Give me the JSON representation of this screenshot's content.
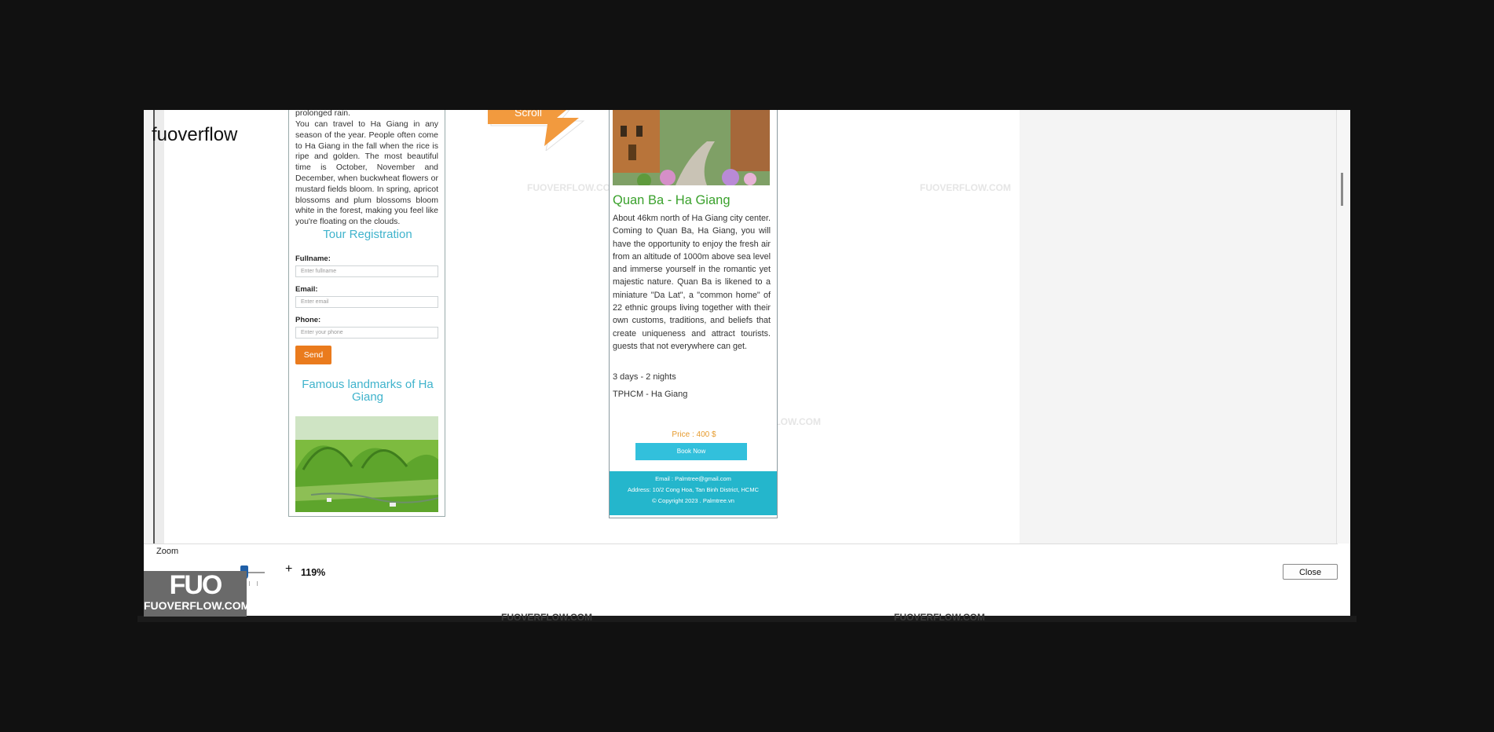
{
  "app": {
    "title": "fuoverflow"
  },
  "left_page": {
    "para_top": "prolonged rain.",
    "para_main": "You can travel to Ha Giang in any season of the year. People often come to Ha Giang in the fall when the rice is ripe and golden. The most beautiful time is October, November and December, when buckwheat flowers or mustard fields bloom. In spring, apricot blossoms and plum blossoms bloom white in the forest, making you feel like you're floating on the clouds.",
    "form_title": "Tour Registration",
    "fullname_label": "Fullname:",
    "fullname_placeholder": "Enter fullname",
    "email_label": "Email:",
    "email_placeholder": "Enter email",
    "phone_label": "Phone:",
    "phone_placeholder": "Enter your phone",
    "send_label": "Send",
    "landmarks_title": "Famous landmarks of Ha Giang"
  },
  "arrow": {
    "label": "Scroll"
  },
  "middle_page": {
    "title": "Quan Ba - Ha Giang",
    "desc": "About 46km north of Ha Giang city center. Coming to Quan Ba, Ha Giang, you will have the opportunity to enjoy the fresh air from an altitude of 1000m above sea level and immerse yourself in the romantic yet majestic nature. Quan Ba is likened to a miniature \"Da Lat\", a \"common home\" of 22 ethnic groups living together with their own customs, traditions, and beliefs that create uniqueness and attract tourists. guests that not everywhere can get.",
    "duration": "3 days - 2 nights",
    "route": "TPHCM - Ha Giang",
    "price": "Price : 400 $",
    "book_label": "Book Now",
    "footer_email": "Email : Palmtree@gmail.com",
    "footer_address": "Address: 10/2 Cong Hoa, Tan Binh District, HCMC",
    "footer_copyright": "© Copyright 2023 . Palmtree.vn"
  },
  "bottom_bar": {
    "zoom_label": "Zoom",
    "zoom_minus": "-",
    "zoom_plus": "+",
    "zoom_value": "119%",
    "zoom_level_percent": 119,
    "close_label": "Close"
  },
  "watermark": {
    "text": "FUOVERFLOW.COM",
    "logo_big": "FUO",
    "logo_small": "FUOVERFLOW.COM"
  },
  "colors": {
    "accent_teal": "#3fb3cc",
    "send_orange": "#ea7b1d",
    "title_green": "#3aa12c",
    "footer_teal": "#24b6cc",
    "zoom_thumb": "#1f5fa7"
  }
}
